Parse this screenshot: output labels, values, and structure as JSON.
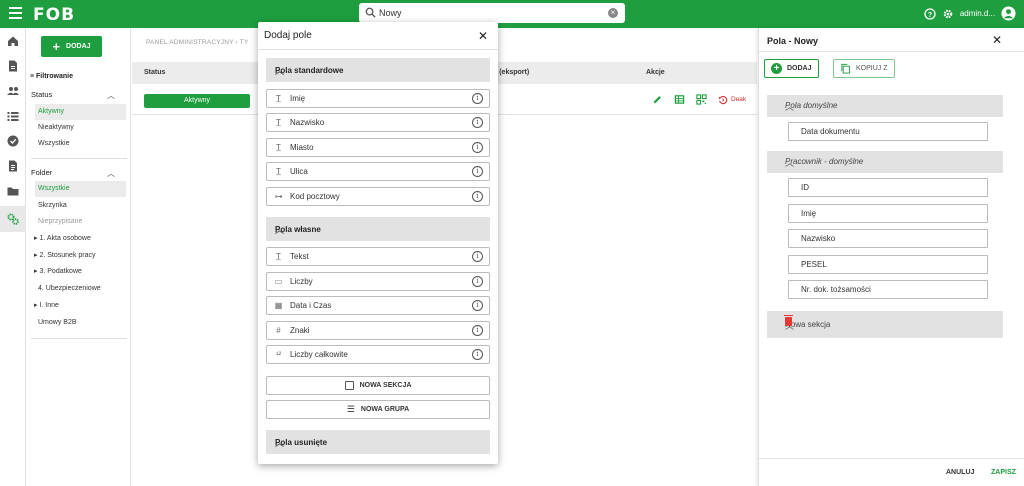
{
  "app": {
    "logo": "FOB"
  },
  "search": {
    "value": "Nowy",
    "placeholder": ""
  },
  "user": {
    "name": "admin.d..."
  },
  "filters": {
    "add_label": "DODAJ",
    "title": "Filtrowanie",
    "status_title": "Status",
    "status_items": [
      "Aktywny",
      "Nieaktywny",
      "Wszystkie"
    ],
    "folder_title": "Folder",
    "folder_items": [
      "Wszystkie",
      "Skrzynka",
      "Nieprzypisane",
      "1. Akta osobowe",
      "2. Stosunek pracy",
      "3. Podatkowe",
      "4. Ubezpieczeniowe",
      "I. Inne",
      "Umowy B2B"
    ]
  },
  "main": {
    "breadcrumb": "PANEL ADMINISTRACYJNY › TY",
    "columns": {
      "status": "Status",
      "export": "d (eksport)",
      "actions": "Akcje"
    },
    "row": {
      "status": "Aktywny",
      "deactivate": "Deak"
    }
  },
  "dialog": {
    "title": "Dodaj pole",
    "group_standard": "Pola standardowe",
    "standard_fields": [
      "Imię",
      "Nazwisko",
      "Miasto",
      "Ulica",
      "Kod pocztowy"
    ],
    "group_custom": "Pola własne",
    "custom_fields": [
      "Tekst",
      "Liczby",
      "Data i Czas",
      "Znaki",
      "Liczby całkowite"
    ],
    "new_section": "NOWA SEKCJA",
    "new_group": "NOWA GRUPA",
    "group_removed": "Pola usunięte"
  },
  "panel": {
    "title": "Pola - Nowy",
    "add_label": "DODAJ",
    "copy_label": "KOPIUJ Z",
    "section1": "Pola domyślne",
    "section1_fields": [
      "Data dokumentu"
    ],
    "section2": "Pracownik - domyślne",
    "section2_fields": [
      "ID",
      "Imię",
      "Nazwisko",
      "PESEL",
      "Nr. dok. tożsamości"
    ],
    "section3": "Nowa sekcja",
    "cancel": "ANULUJ",
    "save": "ZAPISZ"
  },
  "colors": {
    "brand": "#1e9e3e",
    "danger": "#d32f2f"
  }
}
